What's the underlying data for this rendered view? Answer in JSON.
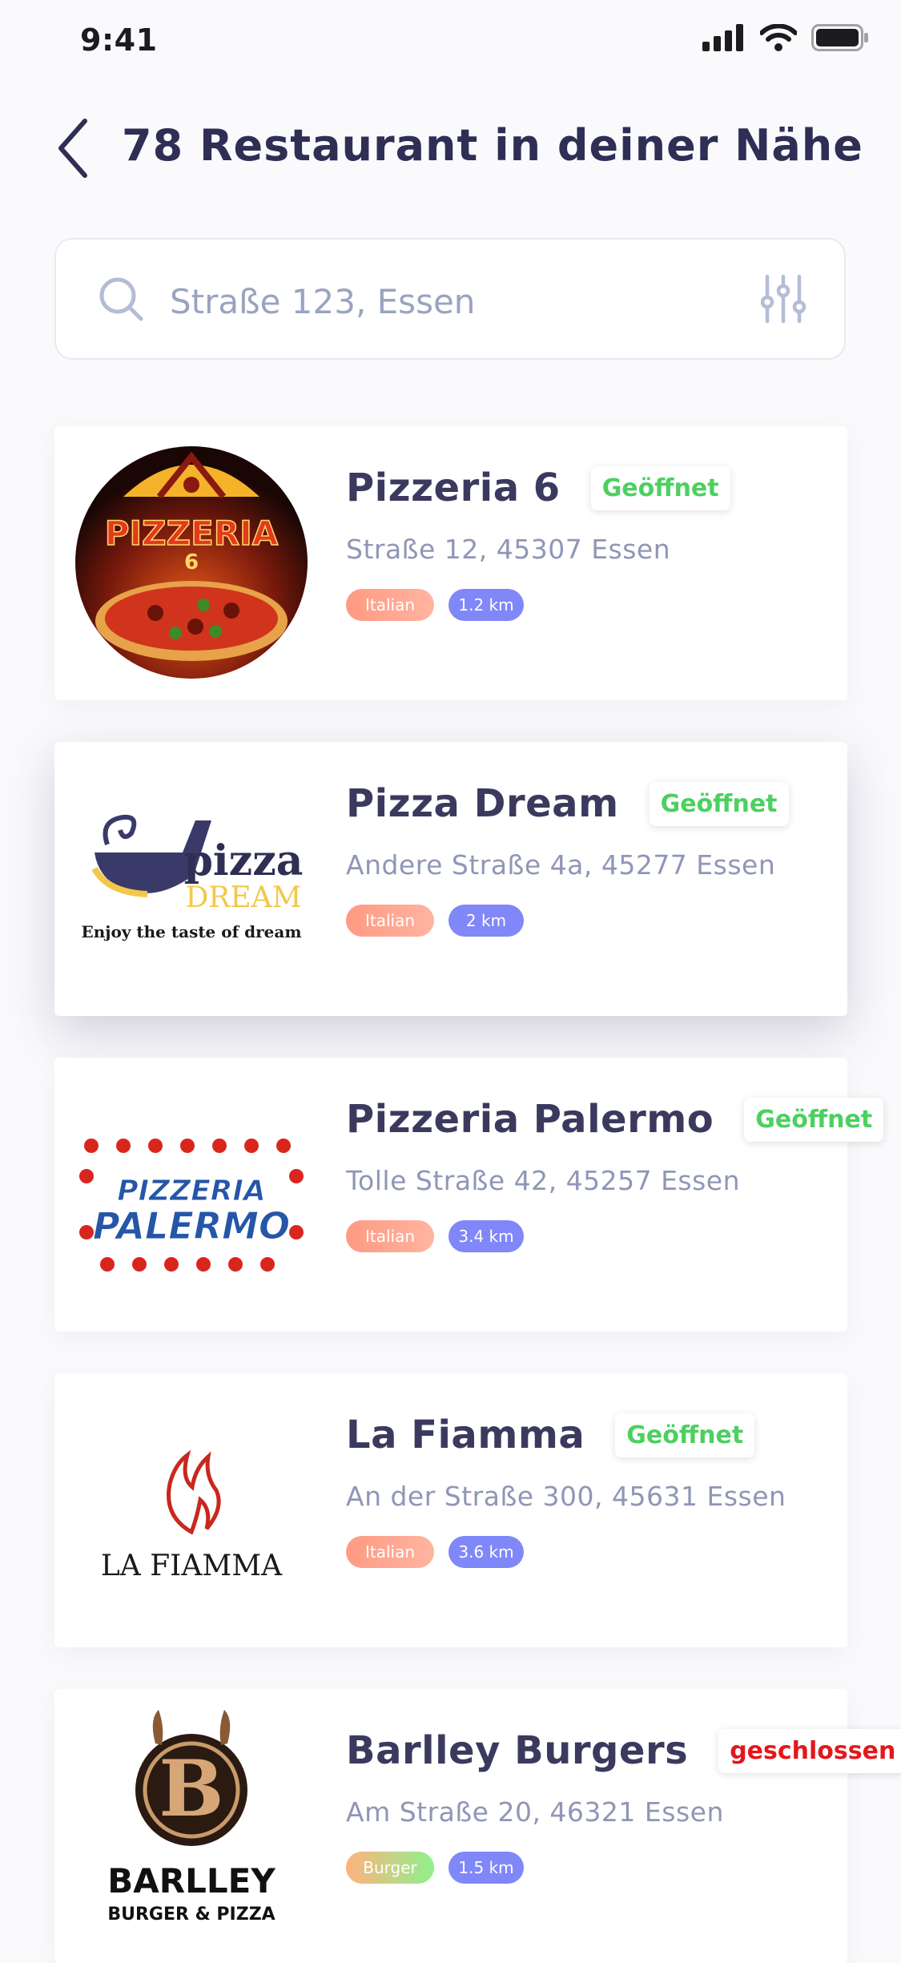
{
  "status_bar": {
    "time": "9:41"
  },
  "header": {
    "title": "78 Restaurant in deiner Nähe"
  },
  "search": {
    "placeholder": "Straße 123, Essen"
  },
  "restaurants": [
    {
      "name": "Pizzeria 6",
      "status": "Geöffnet",
      "address": "Straße 12, 45307 Essen",
      "cuisine": "Italian",
      "distance": "1.2 km",
      "logo_text": [
        "PIZZERIA",
        "6"
      ]
    },
    {
      "name": "Pizza Dream",
      "status": "Geöffnet",
      "address": "Andere Straße 4a, 45277 Essen",
      "cuisine": "Italian",
      "distance": "2 km",
      "logo_text": [
        "pizza",
        "DREAM",
        "Enjoy the taste of dream"
      ]
    },
    {
      "name": "Pizzeria Palermo",
      "status": "Geöffnet",
      "address": "Tolle Straße 42, 45257 Essen",
      "cuisine": "Italian",
      "distance": "3.4 km",
      "logo_text": [
        "PIZZERIA",
        "PALERMO"
      ]
    },
    {
      "name": "La Fiamma",
      "status": "Geöffnet",
      "address": "An der Straße 300, 45631 Essen",
      "cuisine": "Italian",
      "distance": "3.6 km",
      "logo_text": [
        "LA FIAMMA"
      ]
    },
    {
      "name": "Barlley Burgers",
      "status": "geschlossen",
      "address": "Am Straße 20, 46321 Essen",
      "cuisine": "Burger",
      "distance": "1.5 km",
      "logo_text": [
        "BARLLEY",
        "BURGER & PIZZA"
      ]
    }
  ],
  "colors": {
    "open": "#4cd060",
    "closed": "#e4171b",
    "distance_tag": "#8087f8",
    "title": "#2f2e55"
  }
}
